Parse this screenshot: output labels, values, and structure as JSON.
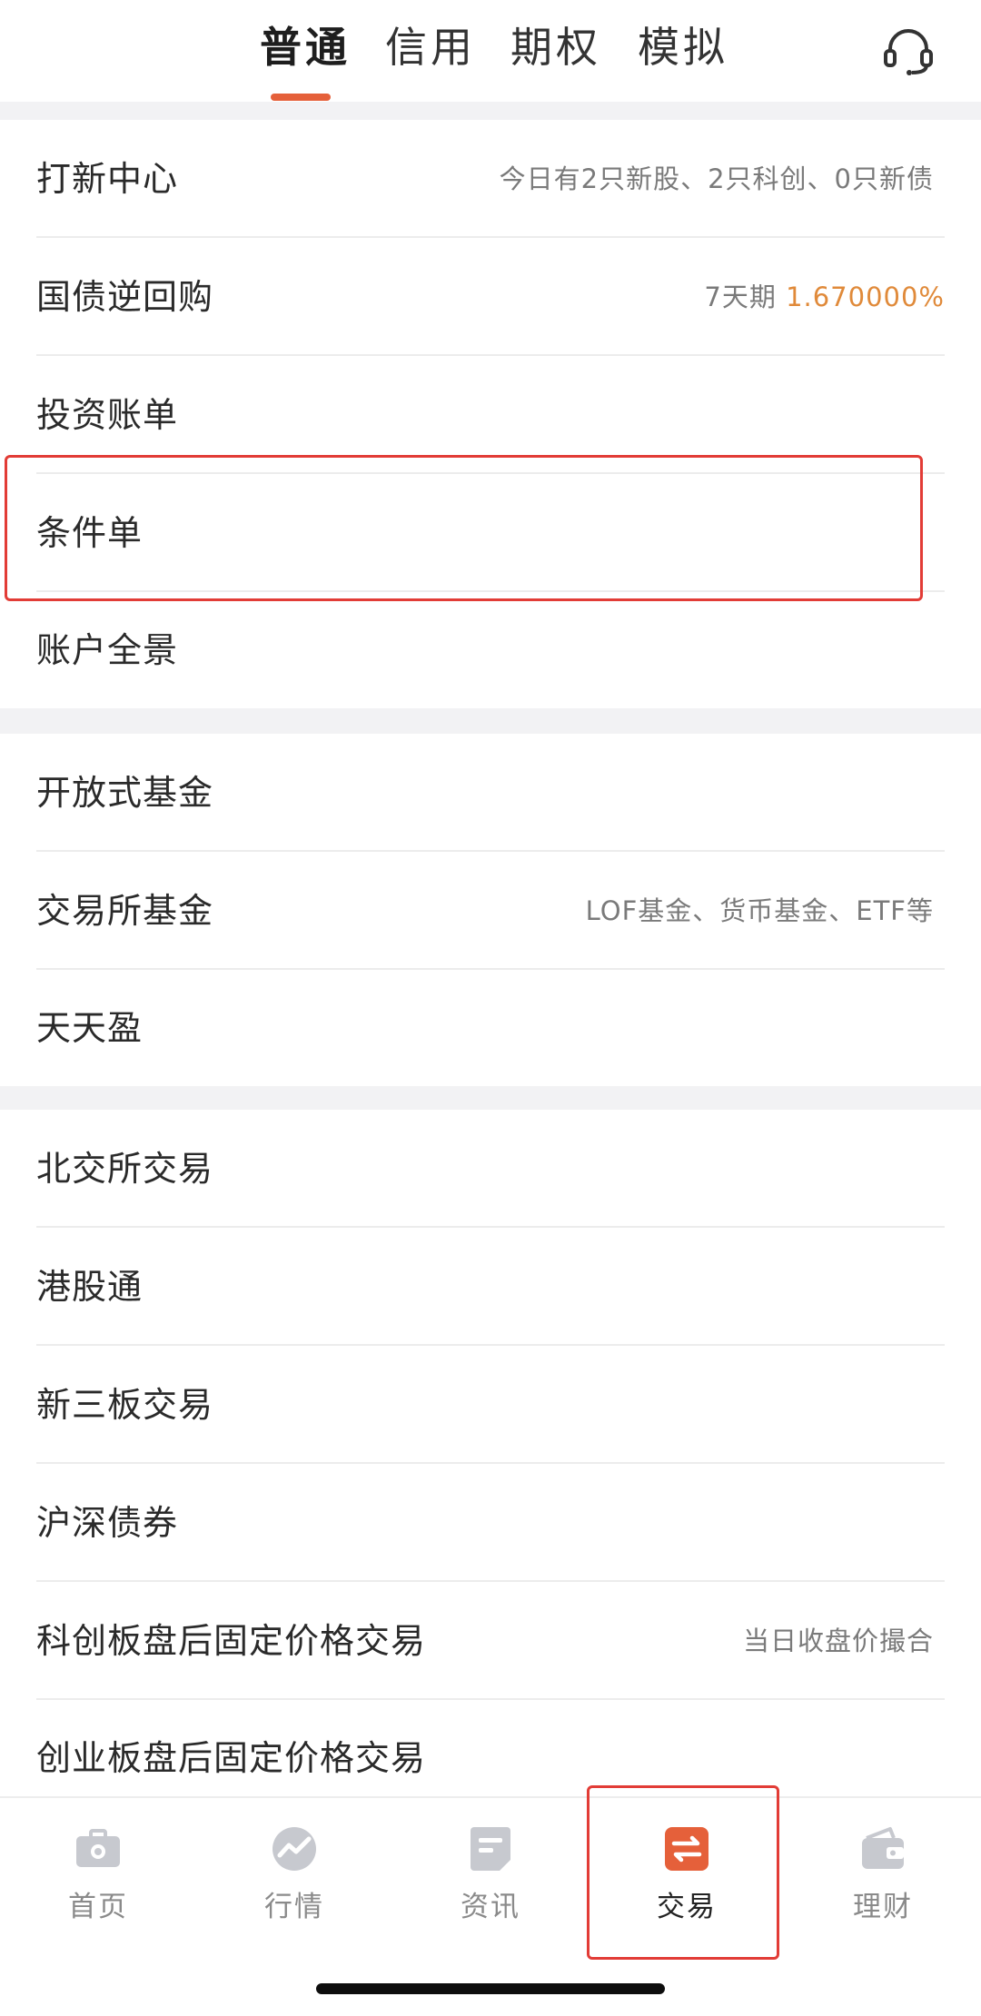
{
  "top_tabs": {
    "items": [
      "普通",
      "信用",
      "期权",
      "模拟"
    ],
    "active_index": 0
  },
  "icons": {
    "support": "headset-icon",
    "home": "briefcase-icon",
    "market": "trend-icon",
    "news": "document-icon",
    "trade": "exchange-icon",
    "wealth": "wallet-icon"
  },
  "colors": {
    "accent": "#e5603a",
    "rate": "#e08a3a",
    "highlight": "#e23c36",
    "nav_inactive": "#c7c9cf"
  },
  "sections": [
    {
      "rows": [
        {
          "label": "打新中心",
          "hint": "今日有2只新股、2只科创、0只新债"
        },
        {
          "label": "国债逆回购",
          "hint_prefix": "7天期",
          "hint_value": "1.670000%"
        },
        {
          "label": "投资账单"
        },
        {
          "label": "条件单",
          "highlighted": true
        },
        {
          "label": "账户全景"
        }
      ]
    },
    {
      "rows": [
        {
          "label": "开放式基金"
        },
        {
          "label": "交易所基金",
          "hint": "LOF基金、货币基金、ETF等"
        },
        {
          "label": "天天盈"
        }
      ]
    },
    {
      "rows": [
        {
          "label": "北交所交易"
        },
        {
          "label": "港股通"
        },
        {
          "label": "新三板交易"
        },
        {
          "label": "沪深债券"
        },
        {
          "label": "科创板盘后固定价格交易",
          "hint": "当日收盘价撮合"
        },
        {
          "label": "创业板盘后固定价格交易"
        }
      ]
    }
  ],
  "bottom_nav": {
    "items": [
      "首页",
      "行情",
      "资讯",
      "交易",
      "理财"
    ],
    "active_index": 3
  }
}
